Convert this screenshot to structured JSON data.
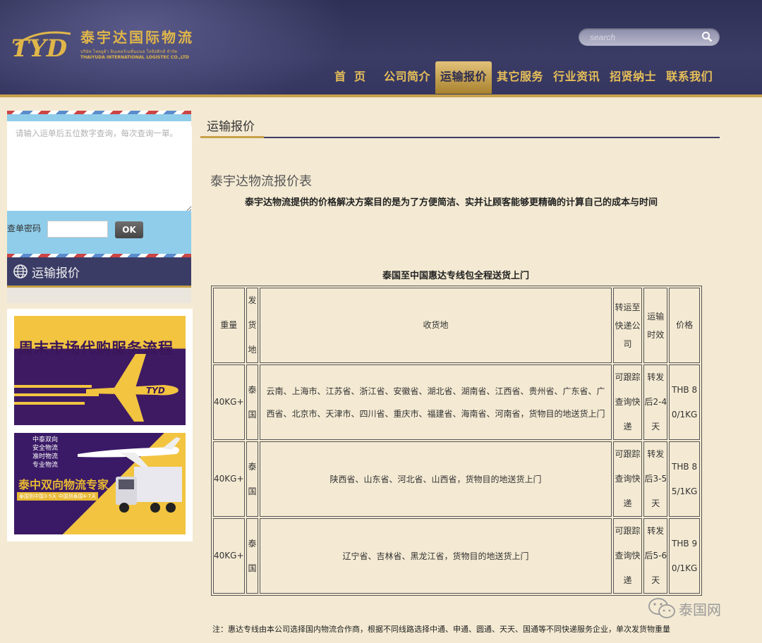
{
  "header": {
    "logo_cn": "泰宇达国际物流",
    "logo_en_small": "บริษัท ไทยยูด้า อินเตอร์เนชั่นแนล โลจิสติกส์ จำกัด",
    "logo_en": "THAIYUDA INTERNATIONAL LOGISTEC CO.,LTD",
    "search_placeholder": "search"
  },
  "nav": [
    {
      "label": "首页"
    },
    {
      "label": "公司简介"
    },
    {
      "label": "运输报价"
    },
    {
      "label": "其它服务"
    },
    {
      "label": "行业资讯"
    },
    {
      "label": "招贤纳士"
    },
    {
      "label": "联系我们"
    }
  ],
  "tracking": {
    "placeholder": "请输入运单后五位数字查询，每次查询一單。",
    "password_label": "查单密码",
    "ok_label": "OK"
  },
  "sidebar_title": "运输报价",
  "ads": {
    "ad1_text": "周末市场代购服务流程",
    "ad2_small": [
      "中泰双向",
      "安全物流",
      "准时物流",
      "专业物流"
    ],
    "ad2_big": "泰中双向物流专家",
    "ad2_bar": "泰国到中国3-5天 中国到泰国4-7天"
  },
  "main": {
    "section_title": "运输报价",
    "quote_title": "泰宇达物流报价表",
    "quote_subtitle": "泰宇达物流提供的价格解决方案目的是为了方便简洁、实并让顾客能够更精确的计算自己的成本与时间",
    "table_caption": "泰国至中国惠达专线包全程送货上门",
    "headers": {
      "weight": "重量",
      "origin": "发货地",
      "destination": "收货地",
      "transfer": "转运至快递公司",
      "time": "运输时效",
      "price": "价格"
    },
    "rows": [
      {
        "weight": "40KG+",
        "origin": "泰国",
        "destination": "云南、上海市、江苏省、浙江省、安徽省、湖北省、湖南省、江西省、贵州省、广东省、广西省、北京市、天津市、四川省、重庆市、福建省、海南省、河南省，货物目的地送货上门",
        "transfer": "可跟踪查询快递",
        "time": "转发后2-4天",
        "price": "THB 80/1KG"
      },
      {
        "weight": "40KG+",
        "origin": "泰国",
        "destination": "陕西省、山东省、河北省、山西省，货物目的地送货上门",
        "transfer": "可跟踪查询快递",
        "time": "转发后3-5天",
        "price": "THB 85/1KG"
      },
      {
        "weight": "40KG+",
        "origin": "泰国",
        "destination": "辽宁省、吉林省、黑龙江省，货物目的地送货上门",
        "transfer": "可跟踪查询快递",
        "time": "转发后5-6天",
        "price": "THB 90/1KG"
      }
    ],
    "note": "注：惠达专线由本公司选择国内物流合作商，根据不同线路选择中通、申通、圆通、天天、国通等不同快递服务企业，单次发货物重量"
  },
  "watermark": "泰国网",
  "colors": {
    "header_bg": "#3b3c66",
    "gold": "#c8a24a",
    "page_bg": "#f4ead3",
    "light_blue": "#8fcdea"
  }
}
